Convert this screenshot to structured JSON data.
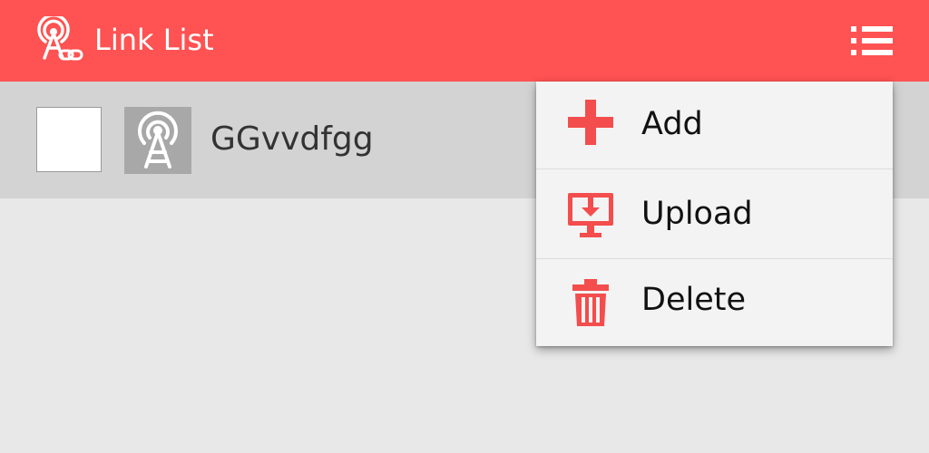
{
  "header": {
    "title": "Link List",
    "logo_icon": "tower-link-icon",
    "menu_icon": "list-menu-icon",
    "background_color": "#ff5252"
  },
  "list": {
    "items": [
      {
        "title": "GGvvdfgg",
        "checked": false,
        "icon": "broadcast-tower-icon"
      }
    ]
  },
  "menu": {
    "items": [
      {
        "label": "Add",
        "icon": "plus-icon"
      },
      {
        "label": "Upload",
        "icon": "upload-monitor-icon"
      },
      {
        "label": "Delete",
        "icon": "trash-icon"
      }
    ],
    "accent_color": "#f44d4d"
  }
}
